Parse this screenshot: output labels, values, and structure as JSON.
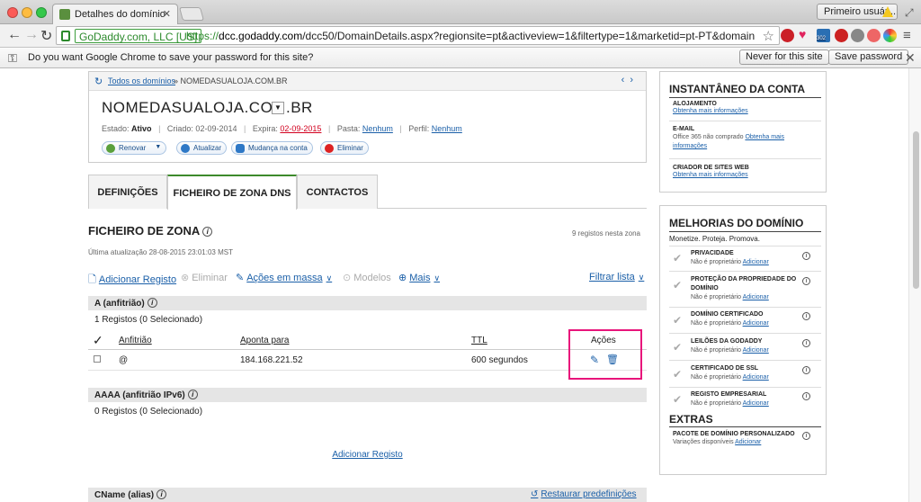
{
  "browser": {
    "tab_title": "Detalhes do domínio",
    "user_button": "Primeiro usuár...",
    "ev_label": "GoDaddy.com, LLC [US]",
    "url_scheme": "https://",
    "url_domain": "dcc.godaddy.com",
    "url_path": "/dcc50/DomainDetails.aspx?regionsite=pt&activeview=1&filtertype=1&marketid=pt-PT&domainid=17...",
    "ext_badge": "302"
  },
  "infobar": {
    "message": "Do you want Google Chrome to save your password for this site?",
    "never_label": "Never for this site",
    "save_label": "Save password"
  },
  "domain": {
    "crumb_link": "Todos os domínios",
    "crumb_current": "» NOMEDASUALOJA.COM.BR",
    "name": "NOMEDASUALOJA.COM.BR",
    "estado_label": "Estado:",
    "estado_value": "Ativo",
    "criado": "Criado: 02-09-2014",
    "expira_label": "Expira:",
    "expira_value": "02-09-2015",
    "pasta_label": "Pasta:",
    "pasta_value": "Nenhum",
    "perfil_label": "Perfil:",
    "perfil_value": "Nenhum",
    "actions": {
      "renovar": "Renovar",
      "atualizar": "Atualizar",
      "mudanca": "Mudança na conta",
      "eliminar": "Eliminar"
    }
  },
  "tabs": [
    "DEFINIÇÕES",
    "FICHEIRO DE ZONA DNS",
    "CONTACTOS"
  ],
  "zone": {
    "title": "FICHEIRO DE ZONA",
    "count": "9 registos nesta zona",
    "updated": "Última atualização 28-08-2015 23:01:03 MST",
    "toolbar": {
      "add": "Adicionar Registo",
      "delete": "Eliminar",
      "bulk": "Ações em massa",
      "models": "Modelos",
      "more": "Mais",
      "filter": "Filtrar lista"
    },
    "a_section": {
      "title": "A (anfitrião)",
      "count": "1 Registos (0 Selecionado)",
      "columns": {
        "host": "Anfitrião",
        "points": "Aponta para",
        "ttl": "TTL",
        "actions": "Ações"
      },
      "rows": [
        {
          "host": "@",
          "points": "184.168.221.52",
          "ttl": "600 segundos"
        }
      ]
    },
    "aaaa_section": {
      "title": "AAAA (anfitrião IPv6)",
      "count": "0 Registos (0 Selecionado)",
      "add": "Adicionar Registo"
    },
    "cname_section": {
      "title": "CName (alias)",
      "restore": "Restaurar predefinições"
    }
  },
  "sidebar": {
    "snapshot": {
      "title": "INSTANTÂNEO DA CONTA",
      "items": [
        {
          "title": "ALOJAMENTO",
          "body": "",
          "link": "Obtenha mais informações"
        },
        {
          "title": "E-MAIL",
          "body": "Office 365 não comprado",
          "link": "Obtenha mais informações"
        },
        {
          "title": "CRIADOR DE SITES WEB",
          "body": "",
          "link": "Obtenha mais informações"
        }
      ]
    },
    "improvements": {
      "title": "MELHORIAS DO DOMÍNIO",
      "subtitle": "Monetize. Proteja. Promova.",
      "status": "Não é proprietário",
      "link": "Adicionar",
      "items": [
        "PRIVACIDADE",
        "PROTEÇÃO DA PROPRIEDADE DO DOMÍNIO",
        "DOMÍNIO CERTIFICADO",
        "LEILÕES DA GODADDY",
        "CERTIFICADO DE SSL",
        "REGISTO EMPRESARIAL"
      ]
    },
    "extras": {
      "title": "EXTRAS",
      "item_title": "PACOTE DE DOMÍNIO PERSONALIZADO",
      "item_body": "Variações disponíveis",
      "item_link": "Adicionar"
    }
  }
}
